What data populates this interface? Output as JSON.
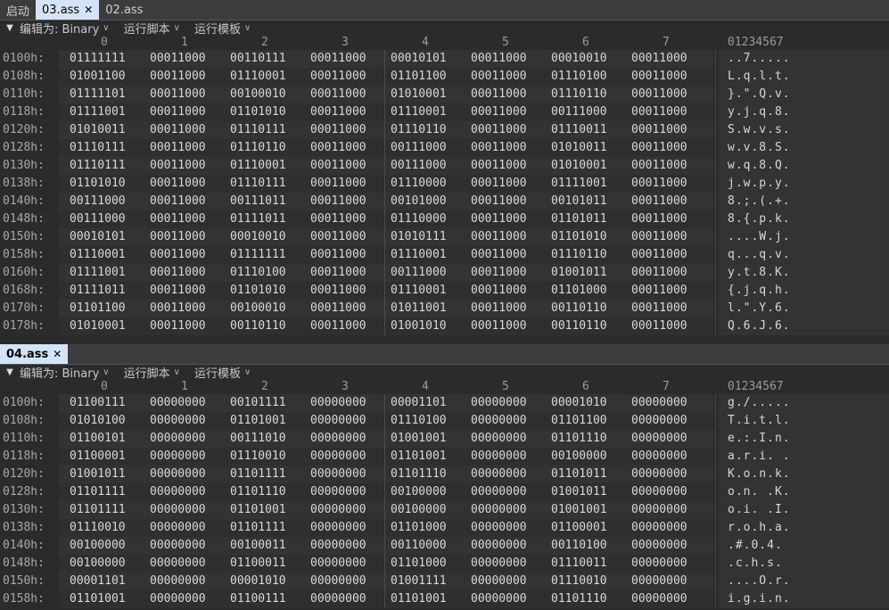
{
  "top_tabs": [
    {
      "label": "启动",
      "active": false,
      "closable": false
    },
    {
      "label": "03.ass",
      "active": true,
      "closable": true
    },
    {
      "label": "02.ass",
      "active": false,
      "closable": false
    }
  ],
  "bottom_tab": {
    "label": "04.ass",
    "closable": true
  },
  "toolbar": {
    "edit_as": "编辑为: Binary",
    "run_script": "运行脚本",
    "run_template": "运行模板"
  },
  "column_headers": [
    "0",
    "1",
    "2",
    "3",
    "4",
    "5",
    "6",
    "7"
  ],
  "ascii_header": "01234567",
  "pane1": {
    "rows": [
      {
        "addr": "0100h:",
        "cells": [
          "01111111",
          "00011000",
          "00110111",
          "00011000",
          "00010101",
          "00011000",
          "00010010",
          "00011000"
        ],
        "ascii": "..7....."
      },
      {
        "addr": "0108h:",
        "cells": [
          "01001100",
          "00011000",
          "01110001",
          "00011000",
          "01101100",
          "00011000",
          "01110100",
          "00011000"
        ],
        "ascii": "L.q.l.t."
      },
      {
        "addr": "0110h:",
        "cells": [
          "01111101",
          "00011000",
          "00100010",
          "00011000",
          "01010001",
          "00011000",
          "01110110",
          "00011000"
        ],
        "ascii": "}.\".Q.v."
      },
      {
        "addr": "0118h:",
        "cells": [
          "01111001",
          "00011000",
          "01101010",
          "00011000",
          "01110001",
          "00011000",
          "00111000",
          "00011000"
        ],
        "ascii": "y.j.q.8."
      },
      {
        "addr": "0120h:",
        "cells": [
          "01010011",
          "00011000",
          "01110111",
          "00011000",
          "01110110",
          "00011000",
          "01110011",
          "00011000"
        ],
        "ascii": "S.w.v.s."
      },
      {
        "addr": "0128h:",
        "cells": [
          "01110111",
          "00011000",
          "01110110",
          "00011000",
          "00111000",
          "00011000",
          "01010011",
          "00011000"
        ],
        "ascii": "w.v.8.S."
      },
      {
        "addr": "0130h:",
        "cells": [
          "01110111",
          "00011000",
          "01110001",
          "00011000",
          "00111000",
          "00011000",
          "01010001",
          "00011000"
        ],
        "ascii": "w.q.8.Q."
      },
      {
        "addr": "0138h:",
        "cells": [
          "01101010",
          "00011000",
          "01110111",
          "00011000",
          "01110000",
          "00011000",
          "01111001",
          "00011000"
        ],
        "ascii": "j.w.p.y."
      },
      {
        "addr": "0140h:",
        "cells": [
          "00111000",
          "00011000",
          "00111011",
          "00011000",
          "00101000",
          "00011000",
          "00101011",
          "00011000"
        ],
        "ascii": "8.;.(.+."
      },
      {
        "addr": "0148h:",
        "cells": [
          "00111000",
          "00011000",
          "01111011",
          "00011000",
          "01110000",
          "00011000",
          "01101011",
          "00011000"
        ],
        "ascii": "8.{.p.k."
      },
      {
        "addr": "0150h:",
        "cells": [
          "00010101",
          "00011000",
          "00010010",
          "00011000",
          "01010111",
          "00011000",
          "01101010",
          "00011000"
        ],
        "ascii": "....W.j."
      },
      {
        "addr": "0158h:",
        "cells": [
          "01110001",
          "00011000",
          "01111111",
          "00011000",
          "01110001",
          "00011000",
          "01110110",
          "00011000"
        ],
        "ascii": "q...q.v."
      },
      {
        "addr": "0160h:",
        "cells": [
          "01111001",
          "00011000",
          "01110100",
          "00011000",
          "00111000",
          "00011000",
          "01001011",
          "00011000"
        ],
        "ascii": "y.t.8.K."
      },
      {
        "addr": "0168h:",
        "cells": [
          "01111011",
          "00011000",
          "01101010",
          "00011000",
          "01110001",
          "00011000",
          "01101000",
          "00011000"
        ],
        "ascii": "{.j.q.h."
      },
      {
        "addr": "0170h:",
        "cells": [
          "01101100",
          "00011000",
          "00100010",
          "00011000",
          "01011001",
          "00011000",
          "00110110",
          "00011000"
        ],
        "ascii": "l.\".Y.6."
      },
      {
        "addr": "0178h:",
        "cells": [
          "01010001",
          "00011000",
          "00110110",
          "00011000",
          "01001010",
          "00011000",
          "00110110",
          "00011000"
        ],
        "ascii": "Q.6.J.6."
      }
    ]
  },
  "pane2": {
    "rows": [
      {
        "addr": "0100h:",
        "cells": [
          "01100111",
          "00000000",
          "00101111",
          "00000000",
          "00001101",
          "00000000",
          "00001010",
          "00000000"
        ],
        "ascii": "g./....."
      },
      {
        "addr": "0108h:",
        "cells": [
          "01010100",
          "00000000",
          "01101001",
          "00000000",
          "01110100",
          "00000000",
          "01101100",
          "00000000"
        ],
        "ascii": "T.i.t.l."
      },
      {
        "addr": "0110h:",
        "cells": [
          "01100101",
          "00000000",
          "00111010",
          "00000000",
          "01001001",
          "00000000",
          "01101110",
          "00000000"
        ],
        "ascii": "e.:.I.n."
      },
      {
        "addr": "0118h:",
        "cells": [
          "01100001",
          "00000000",
          "01110010",
          "00000000",
          "01101001",
          "00000000",
          "00100000",
          "00000000"
        ],
        "ascii": "a.r.i. ."
      },
      {
        "addr": "0120h:",
        "cells": [
          "01001011",
          "00000000",
          "01101111",
          "00000000",
          "01101110",
          "00000000",
          "01101011",
          "00000000"
        ],
        "ascii": "K.o.n.k."
      },
      {
        "addr": "0128h:",
        "cells": [
          "01101111",
          "00000000",
          "01101110",
          "00000000",
          "00100000",
          "00000000",
          "01001011",
          "00000000"
        ],
        "ascii": "o.n. .K."
      },
      {
        "addr": "0130h:",
        "cells": [
          "01101111",
          "00000000",
          "01101001",
          "00000000",
          "00100000",
          "00000000",
          "01001001",
          "00000000"
        ],
        "ascii": "o.i. .I."
      },
      {
        "addr": "0138h:",
        "cells": [
          "01110010",
          "00000000",
          "01101111",
          "00000000",
          "01101000",
          "00000000",
          "01100001",
          "00000000"
        ],
        "ascii": "r.o.h.a."
      },
      {
        "addr": "0140h:",
        "cells": [
          "00100000",
          "00000000",
          "00100011",
          "00000000",
          "00110000",
          "00000000",
          "00110100",
          "00000000"
        ],
        "ascii": " .#.0.4."
      },
      {
        "addr": "0148h:",
        "cells": [
          "00100000",
          "00000000",
          "01100011",
          "00000000",
          "01101000",
          "00000000",
          "01110011",
          "00000000"
        ],
        "ascii": " .c.h.s."
      },
      {
        "addr": "0150h:",
        "cells": [
          "00001101",
          "00000000",
          "00001010",
          "00000000",
          "01001111",
          "00000000",
          "01110010",
          "00000000"
        ],
        "ascii": "....O.r."
      },
      {
        "addr": "0158h:",
        "cells": [
          "01101001",
          "00000000",
          "01100111",
          "00000000",
          "01101001",
          "00000000",
          "01101110",
          "00000000"
        ],
        "ascii": "i.g.i.n."
      }
    ]
  }
}
